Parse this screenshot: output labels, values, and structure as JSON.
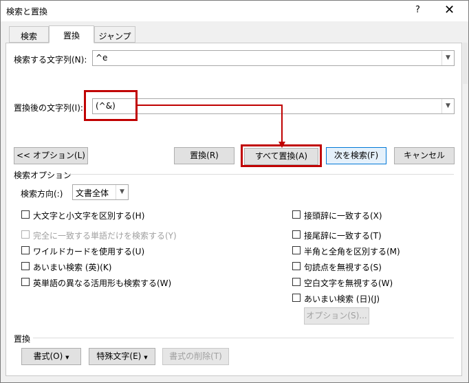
{
  "window": {
    "title": "検索と置換",
    "help": "?",
    "close": "✕"
  },
  "tabs": [
    {
      "label": "検索",
      "active": false
    },
    {
      "label": "置換",
      "active": true
    },
    {
      "label": "ジャンプ",
      "active": false
    }
  ],
  "find": {
    "label": "検索する文字列(N):",
    "value": "^e"
  },
  "replace": {
    "label": "置換後の文字列(I):",
    "value": "(^&)"
  },
  "buttons": {
    "options_less": "<< オプション(L)",
    "replace": "置換(R)",
    "replace_all": "すべて置換(A)",
    "find_next": "次を検索(F)",
    "cancel": "キャンセル",
    "options_fuzzy": "オプション(S)...",
    "format": "書式(O)",
    "special": "特殊文字(E)",
    "no_format": "書式の削除(T)"
  },
  "search_options": {
    "heading": "検索オプション",
    "direction_label": "検索方向(:)",
    "direction_value": "文書全体",
    "left": [
      {
        "label": "大文字と小文字を区別する(H)",
        "checked": false,
        "disabled": false
      },
      {
        "label": "完全に一致する単語だけを検索する(Y)",
        "checked": false,
        "disabled": true
      },
      {
        "label": "ワイルドカードを使用する(U)",
        "checked": false,
        "disabled": false
      },
      {
        "label": "あいまい検索 (英)(K)",
        "checked": false,
        "disabled": false
      },
      {
        "label": "英単語の異なる活用形も検索する(W)",
        "checked": false,
        "disabled": false
      }
    ],
    "right": [
      {
        "label": "接頭辞に一致する(X)",
        "checked": false
      },
      {
        "label": "接尾辞に一致する(T)",
        "checked": false
      },
      {
        "label": "半角と全角を区別する(M)",
        "checked": false
      },
      {
        "label": "句読点を無視する(S)",
        "checked": false
      },
      {
        "label": "空白文字を無視する(W)",
        "checked": false
      },
      {
        "label": "あいまい検索 (日)(J)",
        "checked": false
      }
    ]
  },
  "replace_section": {
    "heading": "置換"
  },
  "colors": {
    "highlight": "#c00000",
    "focus": "#0078d7"
  }
}
